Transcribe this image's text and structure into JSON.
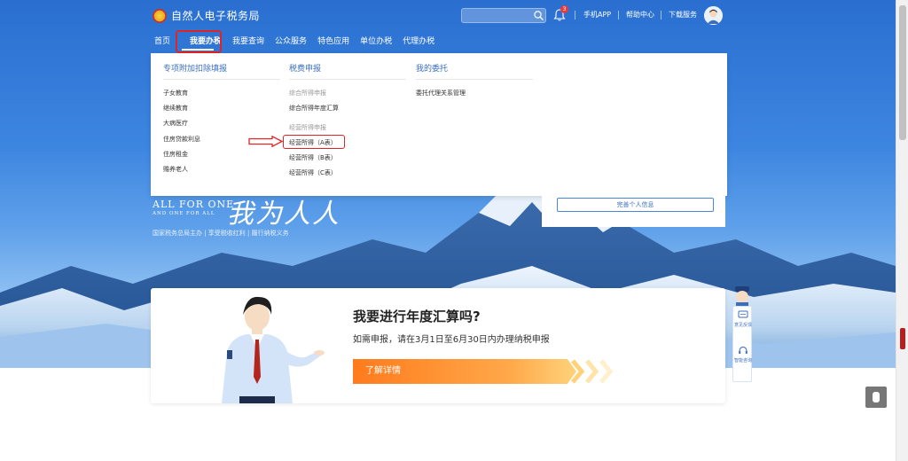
{
  "header": {
    "site_title": "自然人电子税务局",
    "search_placeholder": "",
    "notification_count": "3",
    "links": [
      "手机APP",
      "帮助中心",
      "下载服务"
    ]
  },
  "nav": {
    "items": [
      "首页",
      "我要办税",
      "我要查询",
      "公众服务",
      "特色应用",
      "单位办税",
      "代理办税"
    ],
    "active_index": 1
  },
  "dropdown": {
    "col1": {
      "title": "专项附加扣除填报",
      "items": [
        "子女教育",
        "继续教育",
        "大病医疗",
        "住房贷款利息",
        "住房租金",
        "赡养老人"
      ]
    },
    "col2": {
      "title": "税费申报",
      "sub1": "综合所得申报",
      "sub1_items": [
        "综合所得年度汇算"
      ],
      "sub2": "经营所得申报",
      "sub2_items": [
        "经营所得（A表）",
        "经营所得（B表）",
        "经营所得（C表）"
      ]
    },
    "col3": {
      "title": "我的委托",
      "items": [
        "委托代理关系管理"
      ]
    }
  },
  "hero": {
    "slogan_en_1": "ALL FOR ONE",
    "slogan_en_2": "AND ONE FOR ALL",
    "slogan_cn": "我为人人",
    "tagline": "国家税务总局主办  |  享受税收红利  |  履行纳税义务"
  },
  "profile": {
    "button": "完善个人信息"
  },
  "banner": {
    "title": "我要进行年度汇算吗?",
    "subtitle": "如需申报，请在3月1日至6月30日内办理纳税申报",
    "cta": "了解详情"
  },
  "side_widget": {
    "feedback": "意见反馈",
    "service": "智能咨询"
  },
  "colors": {
    "brand_blue": "#2a6fd0",
    "highlight_red": "#e02424",
    "cta_orange": "#ff7b1c"
  }
}
